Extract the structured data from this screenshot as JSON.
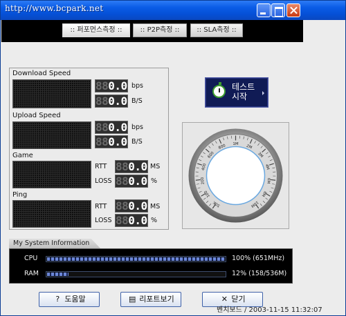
{
  "window": {
    "title": "http://www.bcpark.net"
  },
  "tabs": [
    {
      "label": ":: 퍼포먼스측정 ::",
      "active": true
    },
    {
      "label": ":: P2P측정 ::",
      "active": false
    },
    {
      "label": ":: SLA측정 ::",
      "active": false
    }
  ],
  "measure": {
    "download": {
      "label": "Download Speed",
      "bps_ghost": "88",
      "bps_value": "0.0",
      "bps_unit": "bps",
      "bs_ghost": "88",
      "bs_value": "0.0",
      "bs_unit": "B/S"
    },
    "upload": {
      "label": "Upload Speed",
      "bps_ghost": "88",
      "bps_value": "0.0",
      "bps_unit": "bps",
      "bs_ghost": "88",
      "bs_value": "0.0",
      "bs_unit": "B/S"
    },
    "game": {
      "label": "Game",
      "rtt_label": "RTT",
      "rtt_ghost": "88",
      "rtt_value": "0.0",
      "rtt_unit": "MS",
      "loss_label": "LOSS",
      "loss_ghost": "88",
      "loss_value": "0.0",
      "loss_unit": "%"
    },
    "ping": {
      "label": "Ping",
      "rtt_label": "RTT",
      "rtt_ghost": "88",
      "rtt_value": "0.0",
      "rtt_unit": "MS",
      "loss_label": "LOSS",
      "loss_ghost": "88",
      "loss_value": "0.0",
      "loss_unit": "%"
    }
  },
  "start_button": {
    "label": "테스트\n시작",
    "icon": "stopwatch-icon",
    "icon_color": "#3d9d2e"
  },
  "gauge": {
    "scale_labels": [
      "50K",
      "100",
      "200",
      "400",
      "600",
      "800",
      "1M",
      "2M",
      "3M",
      "4M",
      "6M",
      "8M",
      "10M"
    ],
    "needle_value": 0
  },
  "system_info": {
    "title": "My System Information",
    "cpu": {
      "label": "CPU",
      "percent": 100,
      "value_text": "100% (651MHz)"
    },
    "ram": {
      "label": "RAM",
      "percent": 12,
      "value_text": "12% (158/536M)"
    },
    "bar_color": "#6b86d6"
  },
  "footer": {
    "help": {
      "label": "도움말",
      "icon": "help-icon"
    },
    "report": {
      "label": "리포트보기",
      "icon": "report-icon"
    },
    "close": {
      "label": "닫기",
      "icon": "close-x-icon"
    }
  },
  "watermark": "벤치보드 / 2003-11-15 11:32:07"
}
